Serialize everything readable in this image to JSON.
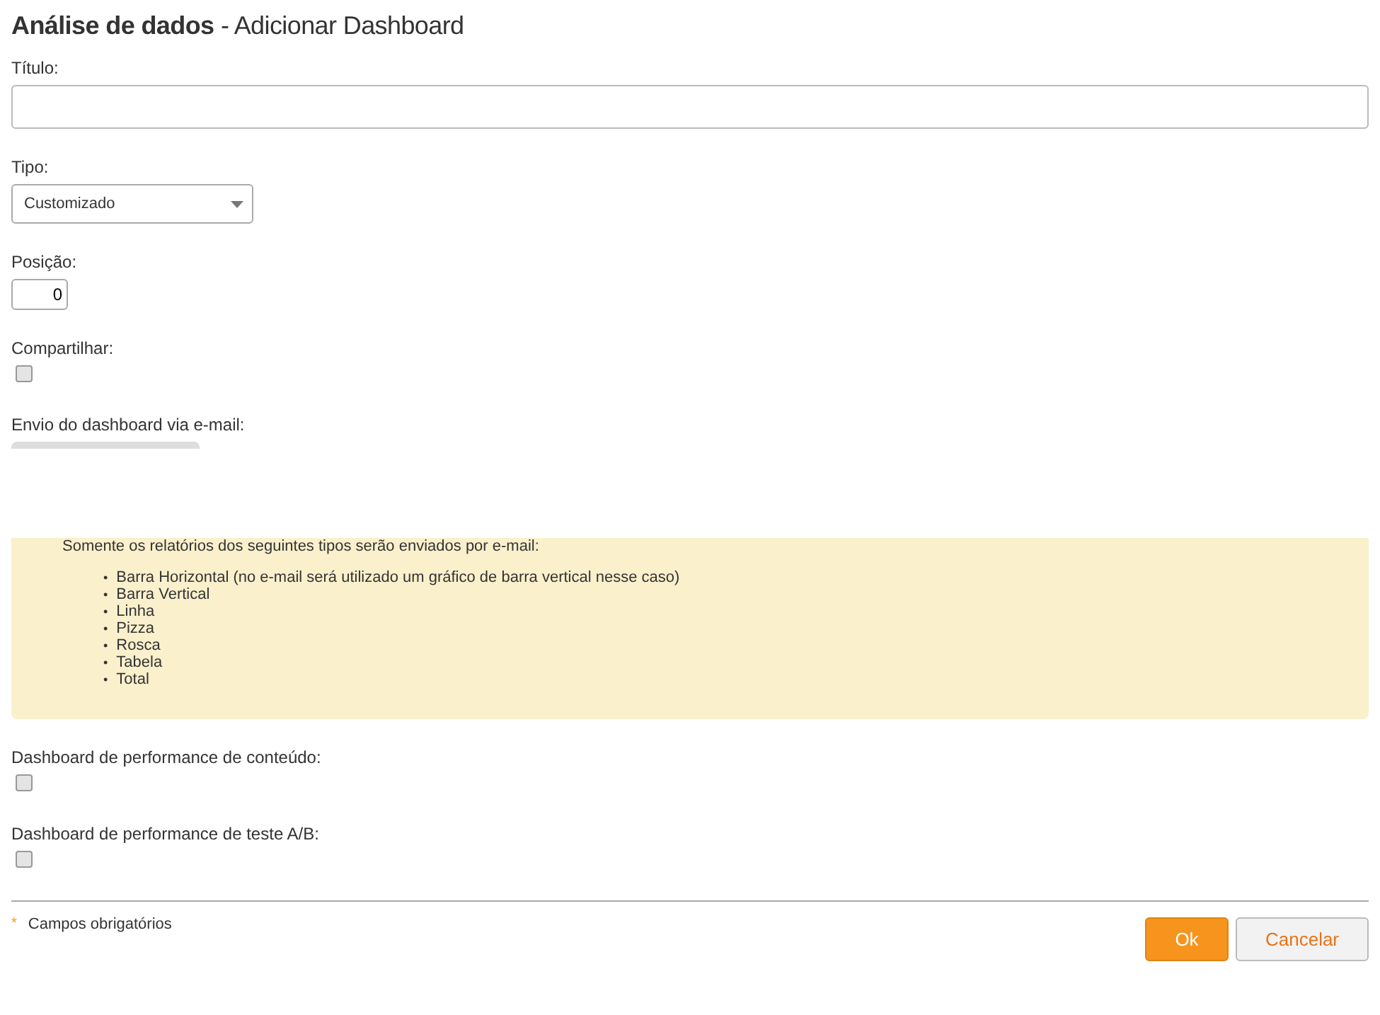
{
  "page_title": {
    "bold": "Análise de dados",
    "rest": " - Adicionar Dashboard"
  },
  "fields": [
    {
      "kind": "text",
      "label": "Título:"
    },
    {
      "kind": "select",
      "label": "Tipo:",
      "value": "Customizado"
    },
    {
      "kind": "number",
      "label": "Posição:",
      "value": "0"
    },
    {
      "kind": "checkbox",
      "label": "Compartilhar:",
      "checked": false
    },
    {
      "kind": "email",
      "label": "Envio do dashboard via e-mail:"
    }
  ],
  "notice": {
    "text": "Somente os relatórios dos seguintes tipos serão enviados por e-mail:",
    "marker": "•",
    "items": [
      "Barra Horizontal (no e-mail será utilizado um gráfico de barra vertical nesse caso)",
      "Barra Vertical",
      "Linha",
      "Pizza",
      "Rosca",
      "Tabela",
      "Total"
    ]
  },
  "extra_fields": [
    {
      "kind": "checkbox",
      "label": "Dashboard de performance de conteúdo:",
      "checked": false
    },
    {
      "kind": "checkbox",
      "label": "Dashboard de performance de teste A/B:",
      "checked": false
    }
  ],
  "footer": {
    "required_mark": "*",
    "required_note": "Campos obrigatórios",
    "buttons": [
      {
        "label": "Ok",
        "kind": "primary"
      },
      {
        "label": "Cancelar",
        "kind": "secondary"
      }
    ]
  }
}
